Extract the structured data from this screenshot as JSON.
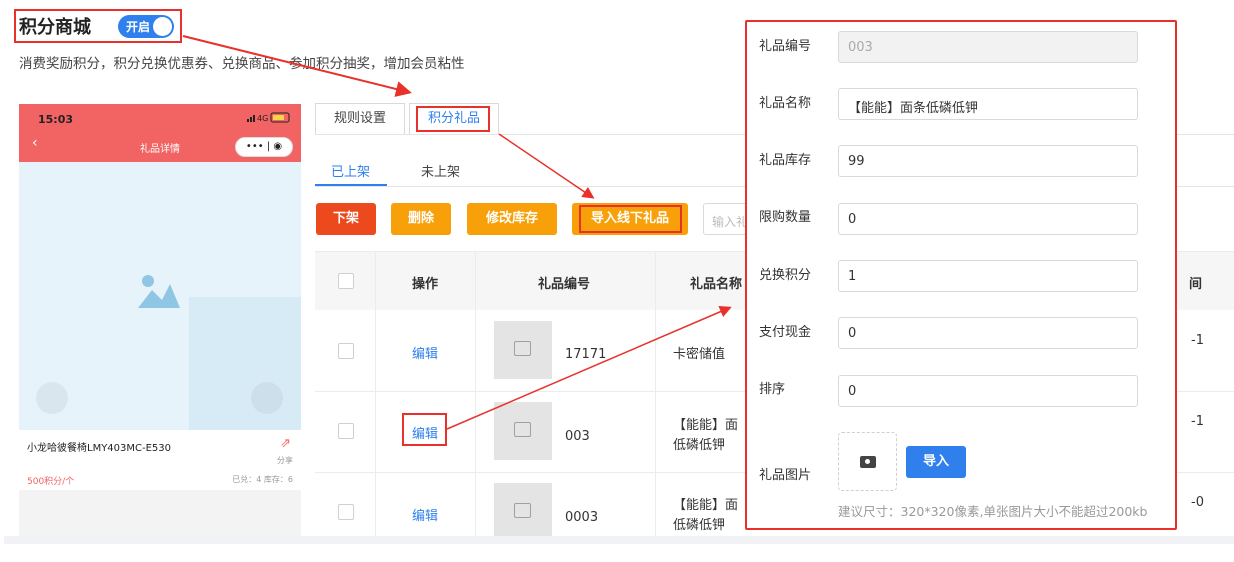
{
  "header": {
    "title": "积分商城",
    "toggle_label": "开启",
    "toggle_on": true,
    "subtitle": "消费奖励积分，积分兑换优惠券、兑换商品、参加积分抽奖，增加会员粘性"
  },
  "phone": {
    "time": "15:03",
    "status": "4G",
    "page_title": "礼品详情",
    "capsule": "••• | ◉",
    "product_name": "小龙哈彼餐椅LMY403MC-E530",
    "share_label": "分享",
    "price": "500积分/个",
    "stock_info": "已兑：4  库存：6"
  },
  "tabs": [
    {
      "label": "规则设置",
      "active": false
    },
    {
      "label": "积分礼品",
      "active": true
    }
  ],
  "subtabs": [
    {
      "label": "已上架",
      "active": true
    },
    {
      "label": "未上架",
      "active": false
    }
  ],
  "actions": {
    "off_shelf": "下架",
    "delete": "删除",
    "edit_stock": "修改库存",
    "import_offline": "导入线下礼品",
    "search_placeholder": "输入礼品"
  },
  "table": {
    "columns": [
      "操作",
      "礼品编号",
      "礼品名称",
      "间"
    ],
    "rows": [
      {
        "action": "编辑",
        "code": "17171",
        "name": "卡密储值",
        "name_line2": "",
        "tail": "-1"
      },
      {
        "action": "编辑",
        "code": "003",
        "name": "【能能】面",
        "name_line2": "低磷低钾",
        "tail": "-1"
      },
      {
        "action": "编辑",
        "code": "0003",
        "name": "【能能】面",
        "name_line2": "低磷低钾",
        "tail": "-0"
      }
    ]
  },
  "form": {
    "code_label": "礼品编号",
    "code_value": "003",
    "name_label": "礼品名称",
    "name_value": "【能能】面条低磷低钾",
    "stock_label": "礼品库存",
    "stock_value": "99",
    "limit_label": "限购数量",
    "limit_value": "0",
    "points_label": "兑换积分",
    "points_value": "1",
    "cash_label": "支付现金",
    "cash_value": "0",
    "sort_label": "排序",
    "sort_value": "0",
    "image_label": "礼品图片",
    "import_button": "导入",
    "hint": "建议尺寸：320*320像素,单张图片大小不能超过200kb"
  },
  "colors": {
    "primary": "#2f80ed",
    "danger": "#ec4a1d",
    "warning": "#f7a00a",
    "annotation_red": "#e8312a",
    "phone_header": "#f26464"
  },
  "icons": [
    "image-placeholder-icon",
    "camera-icon",
    "share-icon",
    "back-arrow-icon"
  ]
}
